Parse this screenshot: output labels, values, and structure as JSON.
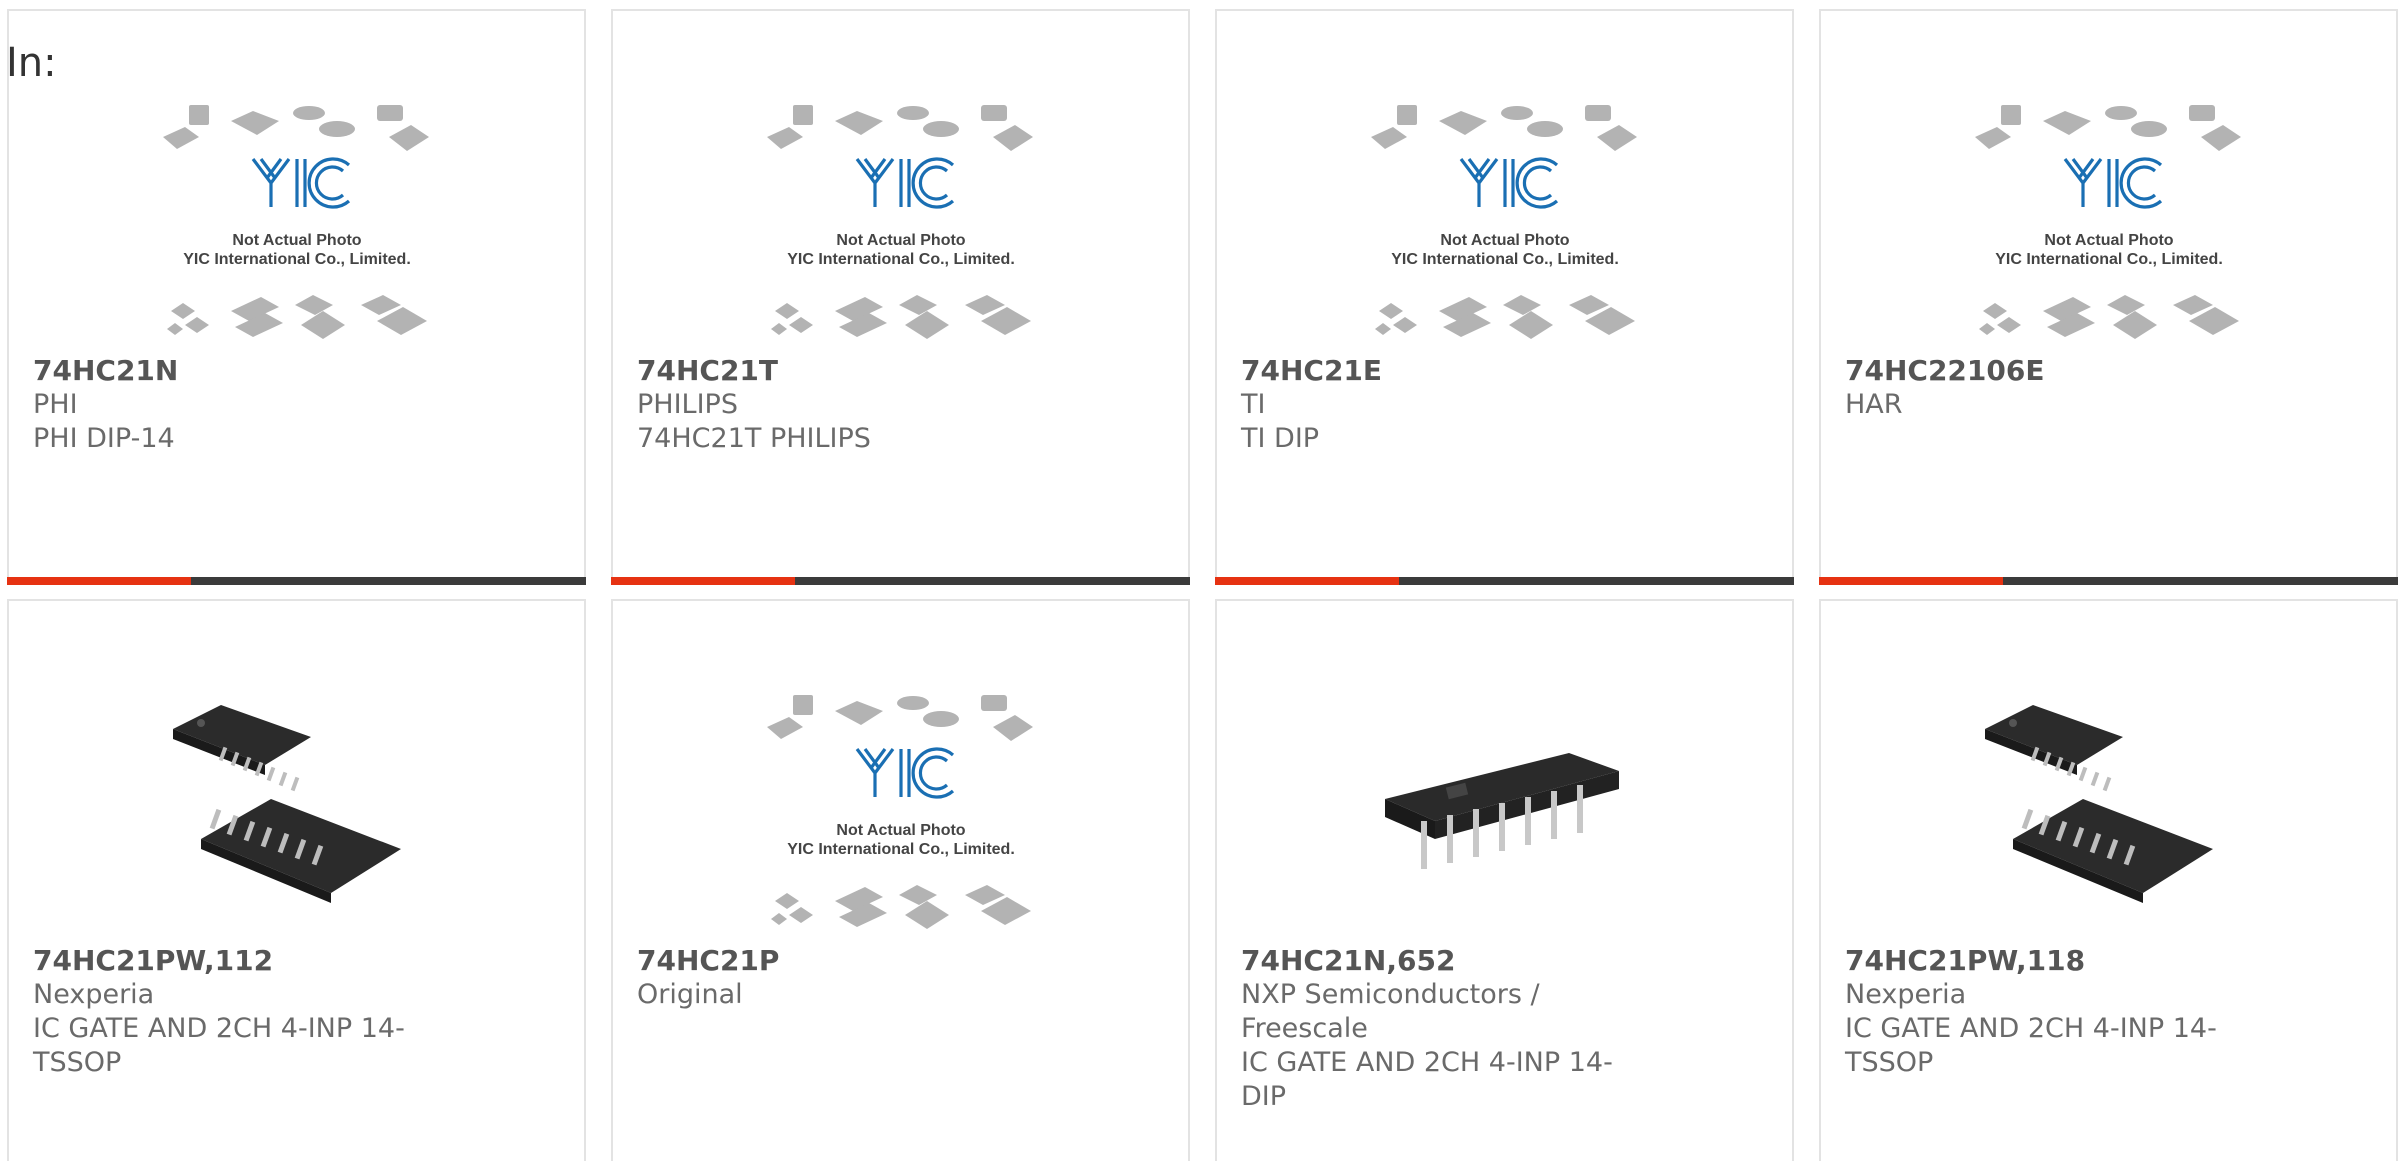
{
  "header": {
    "label": "In:"
  },
  "colors": {
    "accent": "#e63212",
    "bar": "#3b3b3b",
    "logo": "#1a6fb3",
    "border": "#e3e3e3"
  },
  "placeholder_image": {
    "line1": "Not Actual Photo",
    "line2": "YIC International Co., Limited.",
    "logo_text": "YIC"
  },
  "products": [
    {
      "part_number": "74HC21N",
      "manufacturer": "PHI",
      "description": "PHI DIP-14",
      "image": "placeholder"
    },
    {
      "part_number": "74HC21T",
      "manufacturer": "PHILIPS",
      "description": "74HC21T PHILIPS",
      "image": "placeholder"
    },
    {
      "part_number": "74HC21E",
      "manufacturer": "TI",
      "description": "TI DIP",
      "image": "placeholder"
    },
    {
      "part_number": "74HC22106E",
      "manufacturer": "HAR",
      "description": "",
      "image": "placeholder"
    },
    {
      "part_number": "74HC21PW,112",
      "manufacturer": "Nexperia",
      "description": "IC GATE AND 2CH 4-INP 14-TSSOP",
      "image": "tssop-chip"
    },
    {
      "part_number": "74HC21P",
      "manufacturer": "Original",
      "description": "",
      "image": "placeholder"
    },
    {
      "part_number": "74HC21N,652",
      "manufacturer": "NXP Semiconductors / Freescale",
      "description": "IC GATE AND 2CH 4-INP 14-DIP",
      "image": "dip-chip"
    },
    {
      "part_number": "74HC21PW,118",
      "manufacturer": "Nexperia",
      "description": "IC GATE AND 2CH 4-INP 14-TSSOP",
      "image": "tssop-chip"
    }
  ]
}
